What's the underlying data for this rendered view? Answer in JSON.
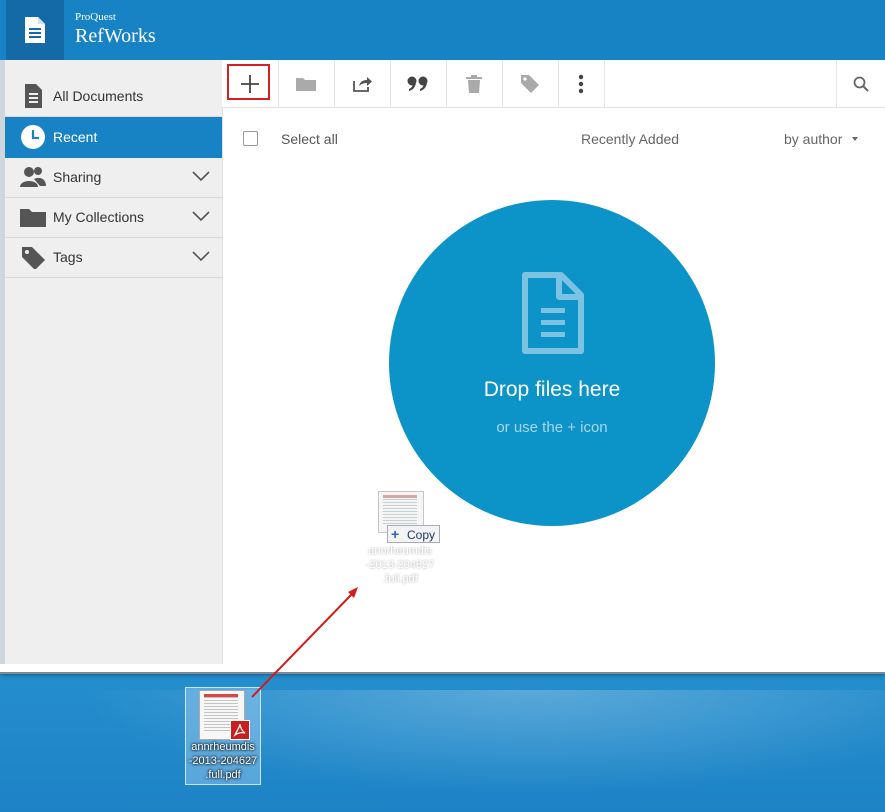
{
  "header": {
    "brand_small": "ProQuest",
    "brand_big": "RefWorks"
  },
  "sidebar": {
    "items": [
      {
        "label": "All Documents",
        "icon": "document-icon",
        "active": false
      },
      {
        "label": "Recent",
        "icon": "clock-icon",
        "active": true
      },
      {
        "label": "Sharing",
        "icon": "people-icon",
        "active": false
      },
      {
        "label": "My Collections",
        "icon": "folder-icon",
        "active": false
      },
      {
        "label": "Tags",
        "icon": "tag-icon",
        "active": false
      }
    ]
  },
  "toolbar": {
    "buttons": [
      "plus-icon",
      "folder-icon",
      "share-icon",
      "quote-icon",
      "trash-icon",
      "tag-icon",
      "more-vertical-icon"
    ],
    "search_icon": "search-icon"
  },
  "list": {
    "select_all": "Select all",
    "sort_field": "Recently Added",
    "sort_by": "by author"
  },
  "dropzone": {
    "title": "Drop files here",
    "subtitle": "or use the + icon"
  },
  "drag": {
    "badge_label": "Copy",
    "file_name": "annrheumdis-2013-204627.full.pdf",
    "name_line1": "annrheumdis",
    "name_line2": "-2013-204627",
    "name_line3": ".full.pdf"
  },
  "desktop_file": {
    "name_line1": "annrheumdis",
    "name_line2": "-2013-204627",
    "name_line3": ".full.pdf"
  },
  "colors": {
    "brand_blue": "#1782c4",
    "drop_circle": "#0c93c7",
    "highlight_red": "#d42020"
  }
}
